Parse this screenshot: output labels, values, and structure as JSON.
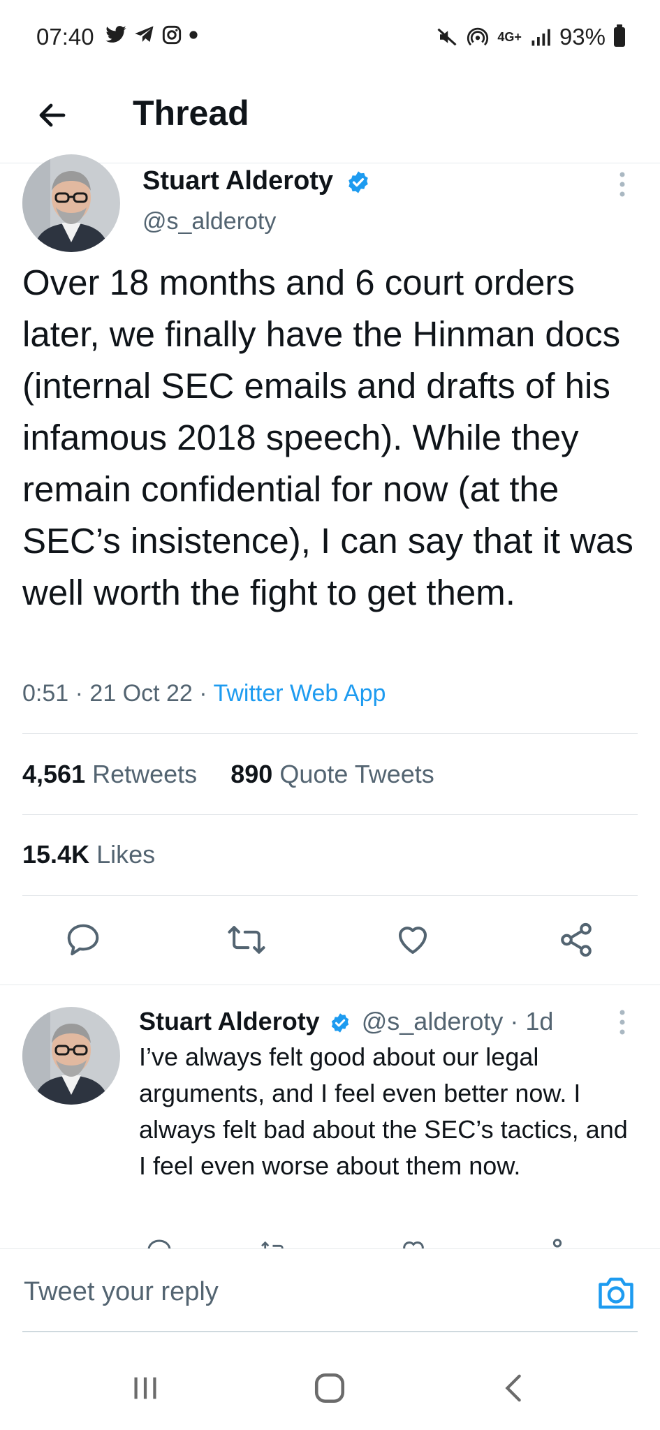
{
  "status_bar": {
    "time": "07:40",
    "left_icons": [
      "twitter-icon",
      "telegram-icon",
      "instagram-icon",
      "dot-icon"
    ],
    "network": "4G+",
    "battery": "93%"
  },
  "header": {
    "back_icon": "arrow-left-icon",
    "title": "Thread"
  },
  "main_tweet": {
    "author_name": "Stuart Alderoty",
    "handle": "@s_alderoty",
    "verified": true,
    "text": "Over 18 months and 6 court orders later, we finally have the Hinman docs (internal SEC emails and drafts of his infamous 2018 speech). While they remain confidential for now (at the SEC’s insistence), I can say that it was well worth the fight to get them.",
    "time": "0:51",
    "date": "21 Oct 22",
    "source": "Twitter Web App",
    "retweets_count": "4,561",
    "retweets_label": "Retweets",
    "quotes_count": "890",
    "quotes_label": "Quote Tweets",
    "likes_count": "15.4K",
    "likes_label": "Likes"
  },
  "reply_tweet": {
    "author_name": "Stuart Alderoty",
    "handle": "@s_alderoty",
    "age": "1d",
    "text": "I’ve always felt good about our legal arguments, and I feel even better now. I always felt bad about the SEC’s tactics, and I feel even worse about them now."
  },
  "composer": {
    "placeholder": "Tweet your reply"
  },
  "colors": {
    "accent": "#1d9bf0",
    "text_primary": "#0f1419",
    "text_secondary": "#536471",
    "divider": "#e6e9ec"
  }
}
